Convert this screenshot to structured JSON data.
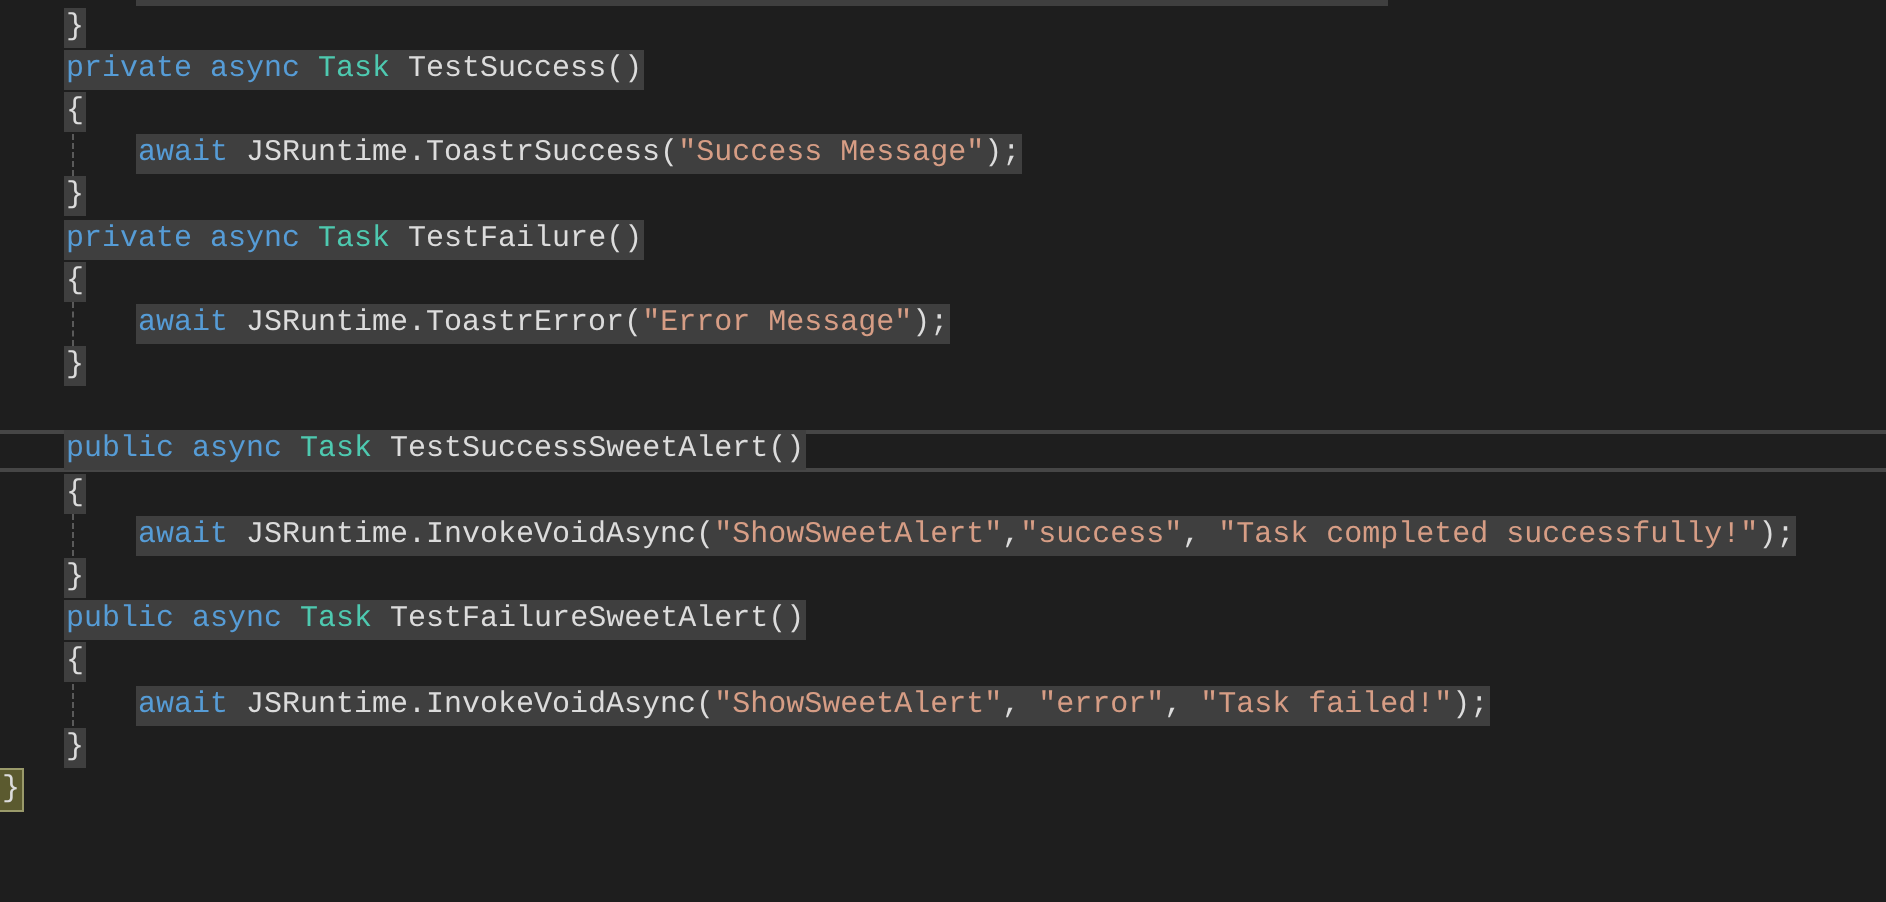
{
  "editor": {
    "lines": [
      {
        "kind": "group",
        "children": [
          {
            "kind": "group",
            "children": [
              {
                "kind": "clipped",
                "selected": true
              }
            ]
          },
          {
            "kind": "code",
            "selected": true,
            "tokens": [
              {
                "text": "}",
                "kind": "plain"
              }
            ]
          },
          {
            "kind": "code",
            "selected": true,
            "tokens": [
              {
                "text": "private",
                "kind": "keyword"
              },
              {
                "text": " async",
                "kind": "keyword"
              },
              {
                "text": " Task",
                "kind": "type"
              },
              {
                "text": " TestSuccess()",
                "kind": "plain"
              }
            ]
          },
          {
            "kind": "code",
            "selected": true,
            "tokens": [
              {
                "text": "{",
                "kind": "plain"
              }
            ]
          },
          {
            "kind": "group",
            "children": [
              {
                "kind": "code",
                "selected": true,
                "tokens": [
                  {
                    "text": "await",
                    "kind": "keyword"
                  },
                  {
                    "text": " JSRuntime.ToastrSuccess(",
                    "kind": "plain"
                  },
                  {
                    "text": "\"Success Message\"",
                    "kind": "string"
                  },
                  {
                    "text": ");",
                    "kind": "plain"
                  }
                ]
              }
            ]
          },
          {
            "kind": "code",
            "selected": true,
            "tokens": [
              {
                "text": "}",
                "kind": "plain"
              }
            ]
          },
          {
            "kind": "code",
            "selected": true,
            "tokens": [
              {
                "text": "private",
                "kind": "keyword"
              },
              {
                "text": " async",
                "kind": "keyword"
              },
              {
                "text": " Task",
                "kind": "type"
              },
              {
                "text": " TestFailure()",
                "kind": "plain"
              }
            ]
          },
          {
            "kind": "code",
            "selected": true,
            "tokens": [
              {
                "text": "{",
                "kind": "plain"
              }
            ]
          },
          {
            "kind": "group",
            "children": [
              {
                "kind": "code",
                "selected": true,
                "tokens": [
                  {
                    "text": "await",
                    "kind": "keyword"
                  },
                  {
                    "text": " JSRuntime.ToastrError(",
                    "kind": "plain"
                  },
                  {
                    "text": "\"Error Message\"",
                    "kind": "string"
                  },
                  {
                    "text": ");",
                    "kind": "plain"
                  }
                ]
              }
            ]
          },
          {
            "kind": "code",
            "selected": true,
            "tokens": [
              {
                "text": "}",
                "kind": "plain"
              }
            ]
          },
          {
            "kind": "blank"
          },
          {
            "kind": "code",
            "selected": true,
            "current": true,
            "tokens": [
              {
                "text": "public",
                "kind": "keyword"
              },
              {
                "text": " async",
                "kind": "keyword"
              },
              {
                "text": " Task",
                "kind": "type"
              },
              {
                "text": " TestSuccessSweetAlert()",
                "kind": "plain"
              }
            ]
          },
          {
            "kind": "code",
            "selected": true,
            "tokens": [
              {
                "text": "{",
                "kind": "plain"
              }
            ]
          },
          {
            "kind": "group",
            "children": [
              {
                "kind": "code",
                "selected": true,
                "tokens": [
                  {
                    "text": "await",
                    "kind": "keyword"
                  },
                  {
                    "text": " JSRuntime.InvokeVoidAsync(",
                    "kind": "plain"
                  },
                  {
                    "text": "\"ShowSweetAlert\"",
                    "kind": "string"
                  },
                  {
                    "text": ",",
                    "kind": "plain"
                  },
                  {
                    "text": "\"success\"",
                    "kind": "string"
                  },
                  {
                    "text": ",",
                    "kind": "plain"
                  },
                  {
                    "text": " \"Task completed successfully!\"",
                    "kind": "string"
                  },
                  {
                    "text": ");",
                    "kind": "plain"
                  }
                ]
              }
            ]
          },
          {
            "kind": "code",
            "selected": true,
            "tokens": [
              {
                "text": "}",
                "kind": "plain"
              }
            ]
          },
          {
            "kind": "code",
            "selected": true,
            "tokens": [
              {
                "text": "public",
                "kind": "keyword"
              },
              {
                "text": " async",
                "kind": "keyword"
              },
              {
                "text": " Task",
                "kind": "type"
              },
              {
                "text": " TestFailureSweetAlert()",
                "kind": "plain"
              }
            ]
          },
          {
            "kind": "code",
            "selected": true,
            "tokens": [
              {
                "text": "{",
                "kind": "plain"
              }
            ]
          },
          {
            "kind": "group",
            "children": [
              {
                "kind": "code",
                "selected": true,
                "tokens": [
                  {
                    "text": "await",
                    "kind": "keyword"
                  },
                  {
                    "text": " JSRuntime.InvokeVoidAsync(",
                    "kind": "plain"
                  },
                  {
                    "text": "\"ShowSweetAlert\"",
                    "kind": "string"
                  },
                  {
                    "text": ",",
                    "kind": "plain"
                  },
                  {
                    "text": " \"error\"",
                    "kind": "string"
                  },
                  {
                    "text": ",",
                    "kind": "plain"
                  },
                  {
                    "text": " \"Task failed!\"",
                    "kind": "string"
                  },
                  {
                    "text": ");",
                    "kind": "plain"
                  }
                ]
              }
            ]
          },
          {
            "kind": "code",
            "selected": true,
            "tokens": [
              {
                "text": "}",
                "kind": "plain"
              }
            ]
          }
        ]
      },
      {
        "kind": "code",
        "brace_match": true,
        "tokens": [
          {
            "text": "}",
            "kind": "plain"
          }
        ]
      }
    ]
  }
}
